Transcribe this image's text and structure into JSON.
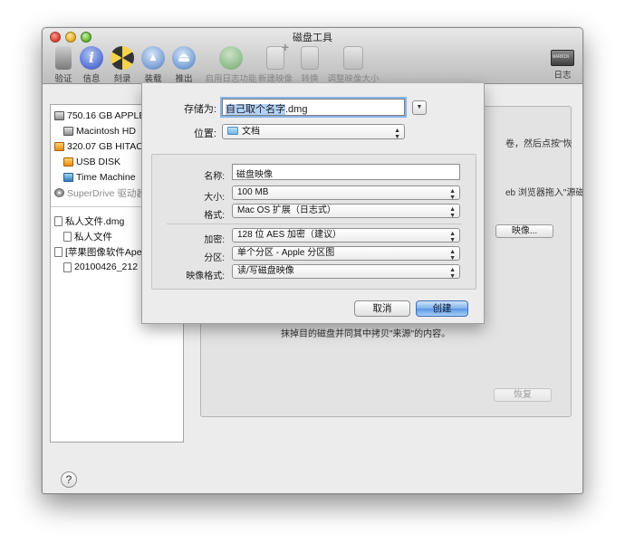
{
  "window": {
    "title": "磁盘工具"
  },
  "toolbar": [
    {
      "name": "verify",
      "label": "验证",
      "dim": false
    },
    {
      "name": "info",
      "label": "信息",
      "dim": false
    },
    {
      "name": "burn",
      "label": "刻录",
      "dim": false
    },
    {
      "name": "mount",
      "label": "装载",
      "dim": false
    },
    {
      "name": "eject",
      "label": "推出",
      "dim": false
    },
    {
      "name": "enable-journaling",
      "label": "启用日志功能",
      "dim": true
    },
    {
      "name": "new-image",
      "label": "新建映像",
      "dim": true
    },
    {
      "name": "convert",
      "label": "转换",
      "dim": true
    },
    {
      "name": "resize-image",
      "label": "调整映像大小",
      "dim": true
    },
    {
      "name": "log",
      "label": "日志",
      "dim": false
    }
  ],
  "sidebar": {
    "items": [
      {
        "label": "750.16 GB APPLE",
        "type": "hdd"
      },
      {
        "label": "Macintosh HD",
        "type": "hdd"
      },
      {
        "label": "320.07 GB HITAC",
        "type": "ext"
      },
      {
        "label": "USB DISK",
        "type": "ext"
      },
      {
        "label": "Time Machine",
        "type": "tm"
      },
      {
        "label": "SuperDrive 驱动器",
        "type": "opt"
      },
      {
        "label": "私人文件.dmg",
        "type": "doc"
      },
      {
        "label": "私人文件",
        "type": "hdd"
      },
      {
        "label": "[苹果图像软件Aper",
        "type": "doc"
      },
      {
        "label": "20100426_212",
        "type": "hdd"
      }
    ]
  },
  "main": {
    "text_right_1": "卷，然后点按\"恢",
    "text_right_2": "eb 浏览器拖入\"源磁",
    "text_bottom": "抹掉目的磁盘并同其中拷贝\"来源\"的内容。",
    "image_button": "映像...",
    "restore_button": "恢复"
  },
  "sheet": {
    "save_as_label": "存储为:",
    "save_as_selected": "自己取个名字",
    "save_as_ext": ".dmg",
    "where_label": "位置:",
    "where_value": "文档",
    "name_label": "名称:",
    "name_value": "磁盘映像",
    "size_label": "大小:",
    "size_value": "100 MB",
    "format_label": "格式:",
    "format_value": "Mac OS 扩展（日志式）",
    "encryption_label": "加密:",
    "encryption_value": "128 位 AES 加密（建议）",
    "partitions_label": "分区:",
    "partitions_value": "单个分区 - Apple 分区图",
    "image_format_label": "映像格式:",
    "image_format_value": "读/写磁盘映像",
    "cancel_button": "取消",
    "create_button": "创建"
  },
  "help": {
    "label": "?"
  }
}
